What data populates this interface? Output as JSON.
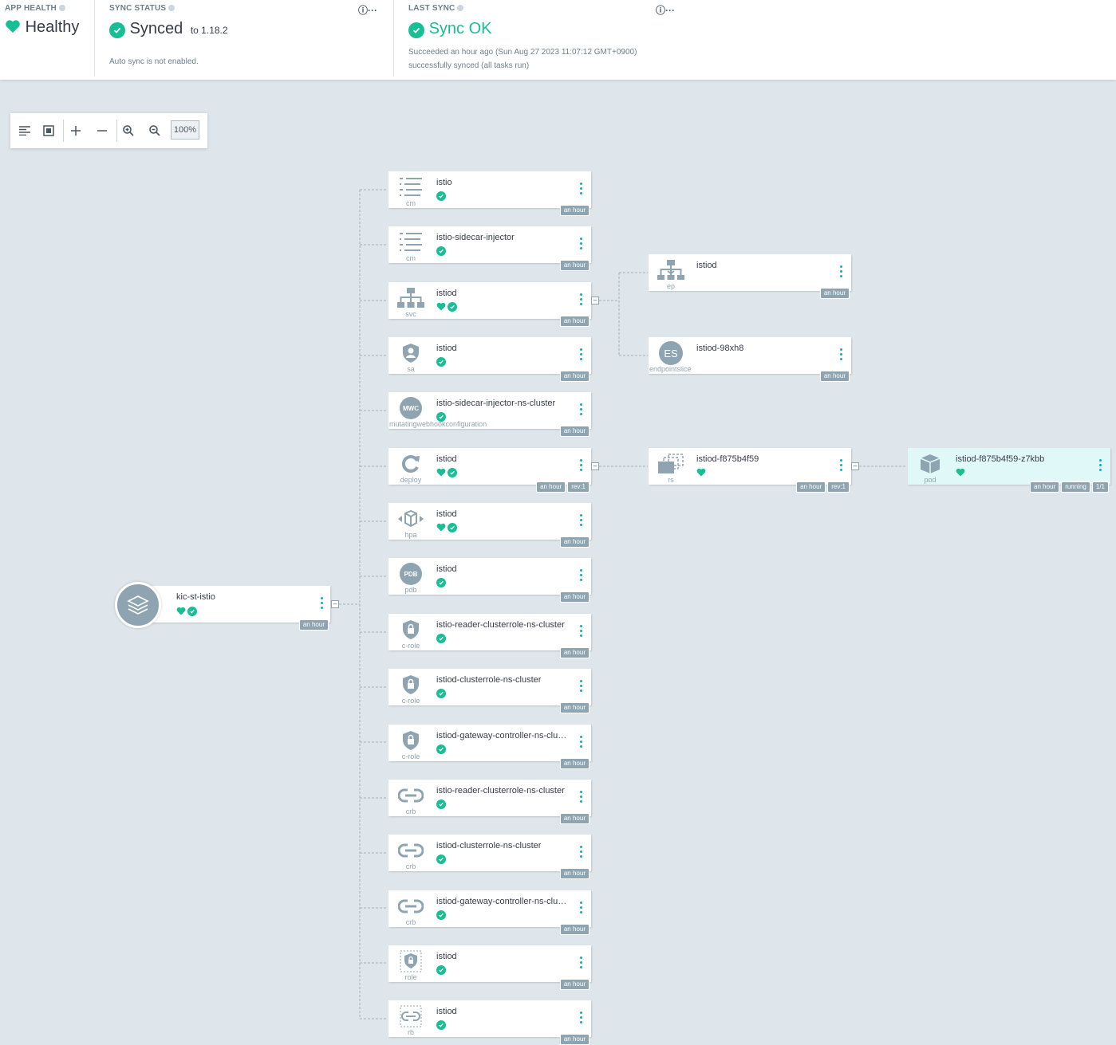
{
  "header": {
    "app_health": {
      "label": "APP HEALTH",
      "value": "Healthy"
    },
    "sync_status": {
      "label": "SYNC STATUS",
      "value": "Synced",
      "target": "to 1.18.2",
      "note": "Auto sync is not enabled."
    },
    "last_sync": {
      "label": "LAST SYNC",
      "value": "Sync OK",
      "line1": "Succeeded an hour ago (Sun Aug 27 2023 11:07:12 GMT+0900)",
      "line2": "successfully synced (all tasks run)"
    }
  },
  "toolbar": {
    "zoom": "100%"
  },
  "colors": {
    "healthy": "#18be94",
    "accent": "#0fb1b8",
    "muted": "#8fa4b1",
    "pod_bg": "#e1f8f8"
  },
  "root": {
    "name": "kic-st-istio",
    "age": "an hour"
  },
  "nodes": [
    {
      "name": "istio",
      "kind": "cm",
      "icon": "configmap-icon",
      "age": "an hour",
      "health": false
    },
    {
      "name": "istio-sidecar-injector",
      "kind": "cm",
      "icon": "configmap-icon",
      "age": "an hour",
      "health": false
    },
    {
      "name": "istiod",
      "kind": "svc",
      "icon": "service-icon",
      "age": "an hour",
      "health": true
    },
    {
      "name": "istiod",
      "kind": "sa",
      "icon": "serviceaccount-icon",
      "age": "an hour",
      "health": false
    },
    {
      "name": "istio-sidecar-injector-ns-cluster",
      "kind": "mutatingwebhookconfiguration",
      "icon": "mwc-icon",
      "age": "an hour",
      "health": false
    },
    {
      "name": "istiod",
      "kind": "deploy",
      "icon": "deployment-icon",
      "age": "an hour",
      "rev": "rev:1",
      "health": true
    },
    {
      "name": "istiod",
      "kind": "hpa",
      "icon": "hpa-icon",
      "age": "an hour",
      "health": true
    },
    {
      "name": "istiod",
      "kind": "pdb",
      "icon": "pdb-icon",
      "age": "an hour",
      "health": false
    },
    {
      "name": "istio-reader-clusterrole-ns-cluster",
      "kind": "c-role",
      "icon": "clusterrole-icon",
      "age": "an hour",
      "health": false
    },
    {
      "name": "istiod-clusterrole-ns-cluster",
      "kind": "c-role",
      "icon": "clusterrole-icon",
      "age": "an hour",
      "health": false
    },
    {
      "name": "istiod-gateway-controller-ns-cluster",
      "kind": "c-role",
      "icon": "clusterrole-icon",
      "age": "an hour",
      "health": false
    },
    {
      "name": "istio-reader-clusterrole-ns-cluster",
      "kind": "crb",
      "icon": "clusterrolebinding-icon",
      "age": "an hour",
      "health": false
    },
    {
      "name": "istiod-clusterrole-ns-cluster",
      "kind": "crb",
      "icon": "clusterrolebinding-icon",
      "age": "an hour",
      "health": false
    },
    {
      "name": "istiod-gateway-controller-ns-cluster",
      "kind": "crb",
      "icon": "clusterrolebinding-icon",
      "age": "an hour",
      "health": false
    },
    {
      "name": "istiod",
      "kind": "role",
      "icon": "role-icon",
      "age": "an hour",
      "health": false
    },
    {
      "name": "istiod",
      "kind": "rb",
      "icon": "rolebinding-icon",
      "age": "an hour",
      "health": false
    }
  ],
  "children": {
    "ep": {
      "name": "istiod",
      "kind": "ep",
      "icon": "endpoints-icon",
      "age": "an hour"
    },
    "es": {
      "name": "istiod-98xh8",
      "kind": "endpointslice",
      "icon_text": "ES",
      "age": "an hour"
    },
    "rs": {
      "name": "istiod-f875b4f59",
      "kind": "rs",
      "icon": "replicaset-icon",
      "age": "an hour",
      "rev": "rev:1"
    },
    "pod": {
      "name": "istiod-f875b4f59-z7kbb",
      "kind": "pod",
      "icon": "pod-icon",
      "age": "an hour",
      "state": "running",
      "ready": "1/1"
    }
  },
  "icon_text": {
    "mwc": "MWC",
    "pdb": "PDB"
  }
}
